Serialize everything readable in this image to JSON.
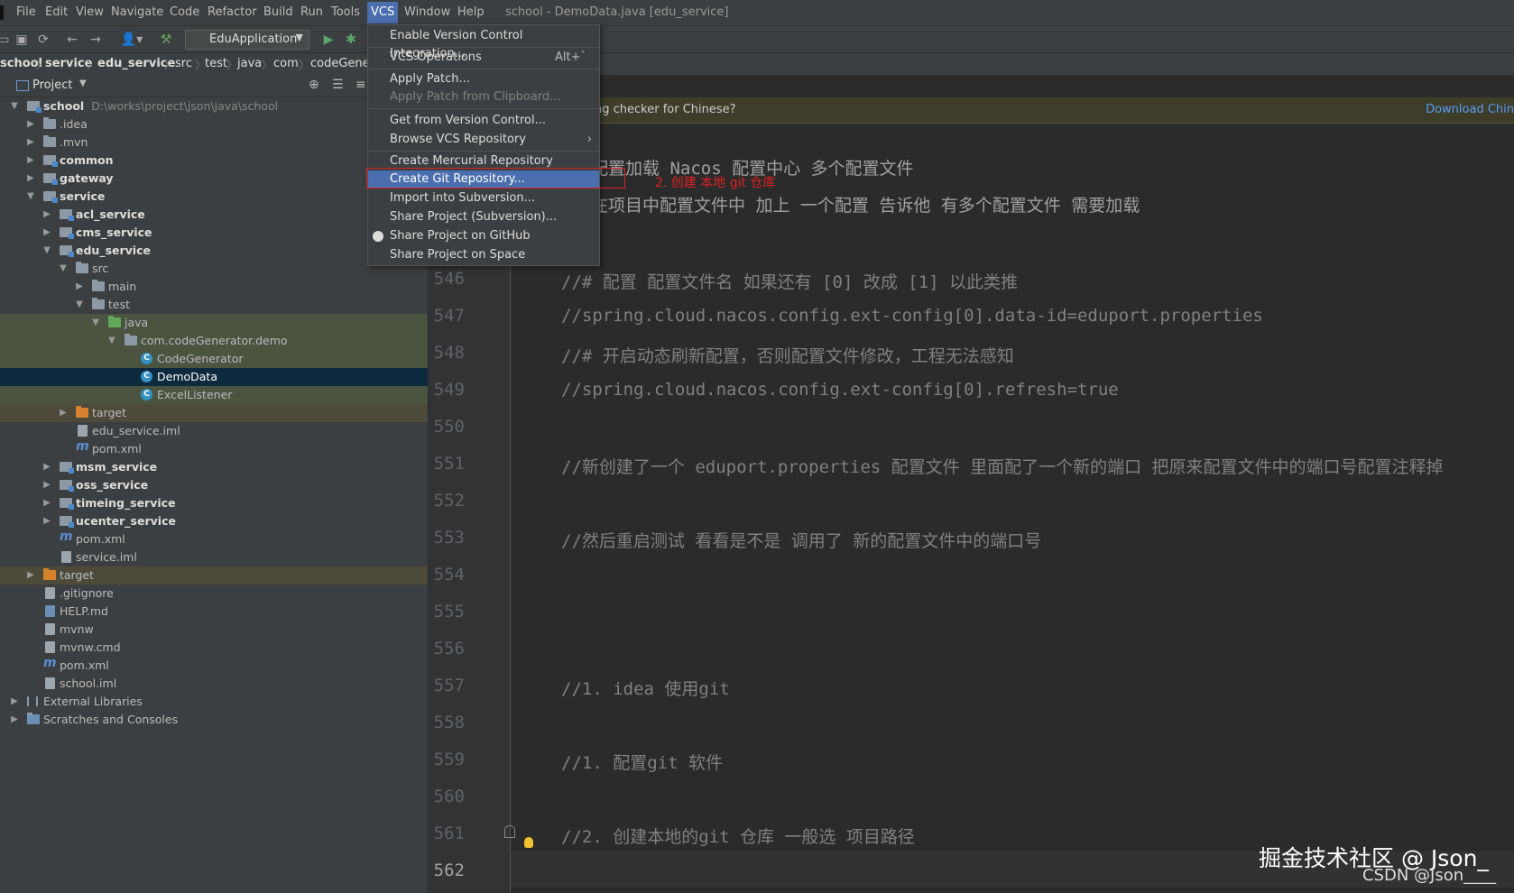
{
  "menubar": {
    "items": [
      "File",
      "Edit",
      "View",
      "Navigate",
      "Code",
      "Refactor",
      "Build",
      "Run",
      "Tools",
      "VCS",
      "Window",
      "Help"
    ],
    "active": "VCS",
    "title": "school - DemoData.java [edu_service]"
  },
  "toolbar": {
    "run_config": "EduApplication"
  },
  "breadcrumb": [
    "school",
    "service",
    "edu_service",
    "src",
    "test",
    "java",
    "com",
    "codeGener"
  ],
  "project": {
    "header": "Project",
    "tree": [
      {
        "label": "school",
        "path": "D:\\works\\project\\json\\java\\school"
      },
      {
        "label": ".idea"
      },
      {
        "label": ".mvn"
      },
      {
        "label": "common"
      },
      {
        "label": "gateway"
      },
      {
        "label": "service"
      },
      {
        "label": "acl_service"
      },
      {
        "label": "cms_service"
      },
      {
        "label": "edu_service"
      },
      {
        "label": "src"
      },
      {
        "label": "main"
      },
      {
        "label": "test"
      },
      {
        "label": "java"
      },
      {
        "label": "com.codeGenerator.demo"
      },
      {
        "label": "CodeGenerator"
      },
      {
        "label": "DemoData"
      },
      {
        "label": "ExcelListener"
      },
      {
        "label": "target"
      },
      {
        "label": "edu_service.iml"
      },
      {
        "label": "pom.xml"
      },
      {
        "label": "msm_service"
      },
      {
        "label": "oss_service"
      },
      {
        "label": "timeing_service"
      },
      {
        "label": "ucenter_service"
      },
      {
        "label": "pom.xml"
      },
      {
        "label": "service.iml"
      },
      {
        "label": "target"
      },
      {
        "label": ".gitignore"
      },
      {
        "label": "HELP.md"
      },
      {
        "label": "mvnw"
      },
      {
        "label": "mvnw.cmd"
      },
      {
        "label": "pom.xml"
      },
      {
        "label": "school.iml"
      },
      {
        "label": "External Libraries"
      },
      {
        "label": "Scratches and Consoles"
      }
    ]
  },
  "vcs_menu": {
    "items": [
      {
        "label": "Enable Version Control Integration..."
      },
      {
        "label": "VCS Operations",
        "shortcut": "Alt+`"
      },
      {
        "label": "Apply Patch..."
      },
      {
        "label": "Apply Patch from Clipboard..."
      },
      {
        "label": "Get from Version Control..."
      },
      {
        "label": "Browse VCS Repository"
      },
      {
        "label": "Create Mercurial Repository"
      },
      {
        "label": "Create Git Repository..."
      },
      {
        "label": "Import into Subversion..."
      },
      {
        "label": "Share Project (Subversion)..."
      },
      {
        "label": "Share Project on GitHub"
      },
      {
        "label": "Share Project on Space"
      }
    ]
  },
  "annotation": "2. 创建 本地 git 仓库",
  "banner": {
    "text": "ng checker for Chinese?",
    "link": "Download Chin"
  },
  "editor": {
    "partial_lines": [
      "配置加载 Nacos 配置中心 多个配置文件",
      "在项目中配置文件中 加上 一个配置 告诉他 有多个配置文件 需要加载"
    ],
    "lines": [
      {
        "n": "546",
        "code": "//# 配置 配置文件名  如果还有 [0] 改成 [1] 以此类推"
      },
      {
        "n": "547",
        "code": "//spring.cloud.nacos.config.ext-config[0].data-id=eduport.properties"
      },
      {
        "n": "548",
        "code": "//# 开启动态刷新配置，否则配置文件修改，工程无法感知"
      },
      {
        "n": "549",
        "code": "//spring.cloud.nacos.config.ext-config[0].refresh=true"
      },
      {
        "n": "550",
        "code": ""
      },
      {
        "n": "551",
        "code": "//新创建了一个 eduport.properties 配置文件 里面配了一个新的端口 把原来配置文件中的端口号配置注释掉"
      },
      {
        "n": "552",
        "code": ""
      },
      {
        "n": "553",
        "code": "//然后重启测试  看看是不是 调用了 新的配置文件中的端口号"
      },
      {
        "n": "554",
        "code": ""
      },
      {
        "n": "555",
        "code": ""
      },
      {
        "n": "556",
        "code": ""
      },
      {
        "n": "557",
        "code": "//1. idea 使用git"
      },
      {
        "n": "558",
        "code": ""
      },
      {
        "n": "559",
        "code": "//1. 配置git 软件"
      },
      {
        "n": "560",
        "code": ""
      },
      {
        "n": "561",
        "code": "//2. 创建本地的git 仓库 一般选 项目路径"
      },
      {
        "n": "562",
        "code": ""
      }
    ]
  },
  "watermark": {
    "line1": "掘金技术社区 @ Json_",
    "line2": "CSDN @Json____"
  }
}
